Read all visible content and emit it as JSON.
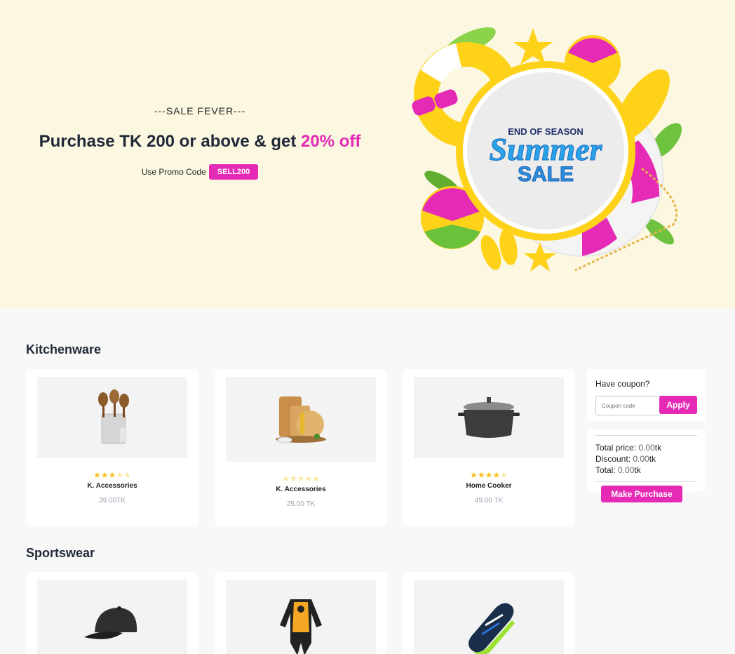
{
  "hero": {
    "tagline": "---SALE FEVER---",
    "headline_prefix": "Purchase TK 200 or above & get ",
    "headline_highlight": "20% off",
    "promo_label": "Use Promo Code",
    "promo_code": "SELL200",
    "art": {
      "line1": "END OF SEASON",
      "line2": "Summer",
      "line3": "SALE"
    }
  },
  "sections": [
    {
      "title": "Kitchenware",
      "products": [
        {
          "name": "K. Accessories",
          "price": "39.00TK",
          "rating": 3,
          "icon": "utensil-holder-icon"
        },
        {
          "name": "K. Accessories",
          "price": "25.00 TK",
          "rating": 0,
          "icon": "cutting-board-icon"
        },
        {
          "name": "Home Cooker",
          "price": "49.00 TK",
          "rating": 4,
          "icon": "cooking-pot-icon"
        }
      ]
    },
    {
      "title": "Sportswear",
      "products": [
        {
          "icon": "cap-icon"
        },
        {
          "icon": "sports-suit-icon"
        },
        {
          "icon": "sneaker-icon"
        }
      ]
    }
  ],
  "coupon": {
    "label": "Have coupon?",
    "placeholder": "Coupon code",
    "apply_label": "Apply"
  },
  "summary": {
    "total_price_label": "Total price:",
    "total_price_value": "0.00",
    "discount_label": "Discount:",
    "discount_value": "0.00",
    "total_label": "Total:",
    "total_value": "0.00",
    "currency": "tk",
    "purchase_label": "Make Purchase"
  },
  "colors": {
    "accent": "#e52bb5",
    "hero_bg": "#fbf7e1",
    "star": "#f5c21b"
  }
}
